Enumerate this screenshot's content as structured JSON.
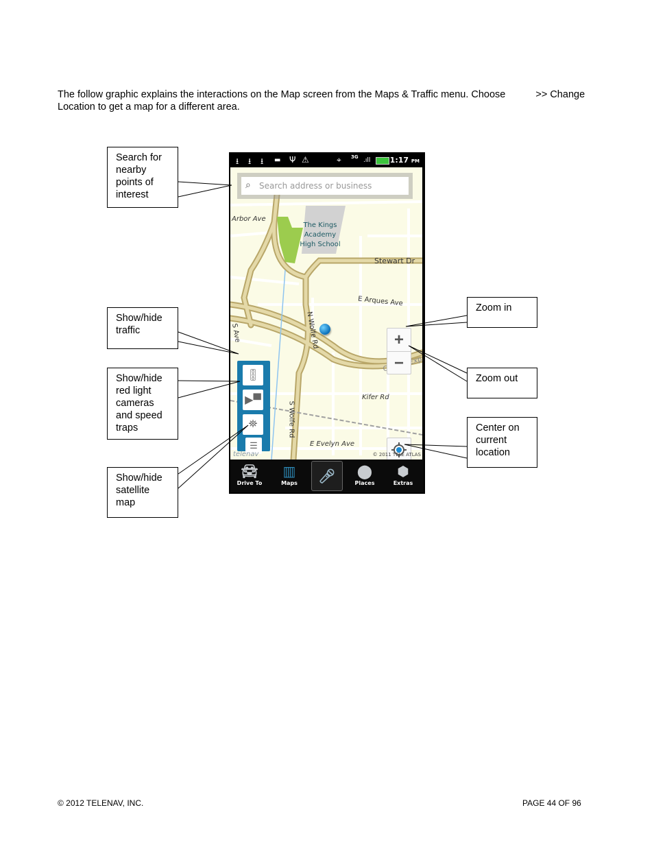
{
  "intro": {
    "line1_a": "The follow graphic explains the interactions on the Map screen from the Maps & Traffic menu. Choose",
    "line1_b": ">> Change",
    "line2": "Location to get a map for a different area."
  },
  "callouts": {
    "search": "Search for nearby points of interest",
    "traffic": "Show/hide traffic",
    "cameras": "Show/hide red light cameras and speed traps",
    "satellite": "Show/hide satellite map",
    "zoom_in": "Zoom in",
    "zoom_out": "Zoom out",
    "center": "Center on current location"
  },
  "phone": {
    "status_bar": {
      "time": "1:17",
      "ampm": "PM",
      "network": "3G",
      "icons": [
        "download-icon",
        "download-icon",
        "download-icon",
        "mail-icon",
        "usb-icon",
        "warning-icon",
        "gps-icon",
        "network-3g-icon",
        "signal-icon",
        "battery-icon"
      ]
    },
    "search_placeholder": "Search address or business",
    "map_labels": {
      "arbor": "Arbor Ave",
      "school": "The Kings Academy High School",
      "stewart": "Stewart Dr",
      "arques": "E Arques Ave",
      "n_wolfe": "N Wolfe Rd",
      "s_wolfe": "S Wolfe Rd",
      "central": "Central Exp",
      "kifer": "Kifer Rd",
      "evelyn": "E Evelyn Ave",
      "s_ave": "S Ave",
      "watermark": "telenav",
      "copyright": "© 2011 TELE ATLAS"
    },
    "zoom_in_symbol": "+",
    "zoom_out_symbol": "−",
    "tabs": [
      {
        "label": "Drive To",
        "icon": "car-icon"
      },
      {
        "label": "Maps",
        "icon": "map-icon"
      },
      {
        "label": "",
        "icon": "microphone-icon"
      },
      {
        "label": "Places",
        "icon": "pin-icon"
      },
      {
        "label": "Extras",
        "icon": "cube-icon"
      }
    ]
  },
  "footer": {
    "copyright": "© 2012 TELENAV, INC.",
    "page": "PAGE 44 OF 96"
  }
}
